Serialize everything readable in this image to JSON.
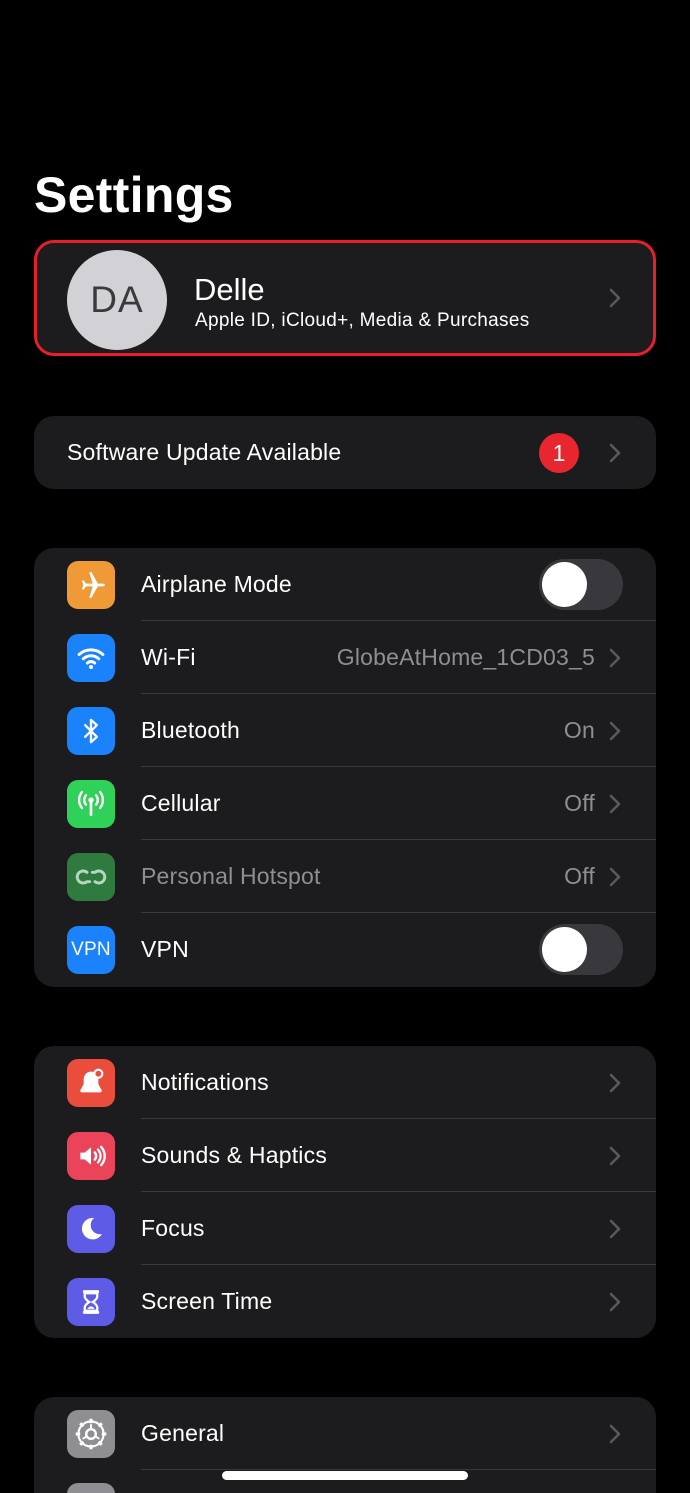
{
  "page": {
    "title": "Settings"
  },
  "profile": {
    "initials": "DA",
    "name": "Delle",
    "subtitle": "Apple ID, iCloud+, Media & Purchases"
  },
  "software_update": {
    "label": "Software Update Available",
    "badge": "1"
  },
  "connectivity": [
    {
      "label": "Airplane Mode",
      "icon": "airplane-icon",
      "color": "#f09a37",
      "control": "toggle",
      "on": false
    },
    {
      "label": "Wi-Fi",
      "icon": "wifi-icon",
      "color": "#1a82fb",
      "value": "GlobeAtHome_1CD03_5"
    },
    {
      "label": "Bluetooth",
      "icon": "bluetooth-icon",
      "color": "#1a82fb",
      "value": "On"
    },
    {
      "label": "Cellular",
      "icon": "cellular-icon",
      "color": "#30d158",
      "value": "Off"
    },
    {
      "label": "Personal Hotspot",
      "icon": "hotspot-icon",
      "color": "#2f7a3e",
      "value": "Off",
      "dimmed": true
    },
    {
      "label": "VPN",
      "icon": "vpn-icon",
      "color": "#1a82fb",
      "control": "toggle",
      "on": false,
      "icon_text": "VPN"
    }
  ],
  "attention": [
    {
      "label": "Notifications",
      "icon": "notifications-icon",
      "color": "#eb4d3d"
    },
    {
      "label": "Sounds & Haptics",
      "icon": "sounds-icon",
      "color": "#eb445a"
    },
    {
      "label": "Focus",
      "icon": "focus-moon-icon",
      "color": "#5e5ce6"
    },
    {
      "label": "Screen Time",
      "icon": "hourglass-icon",
      "color": "#5e5ce6"
    }
  ],
  "system": [
    {
      "label": "General",
      "icon": "gear-icon",
      "color": "#8e8e93"
    }
  ]
}
